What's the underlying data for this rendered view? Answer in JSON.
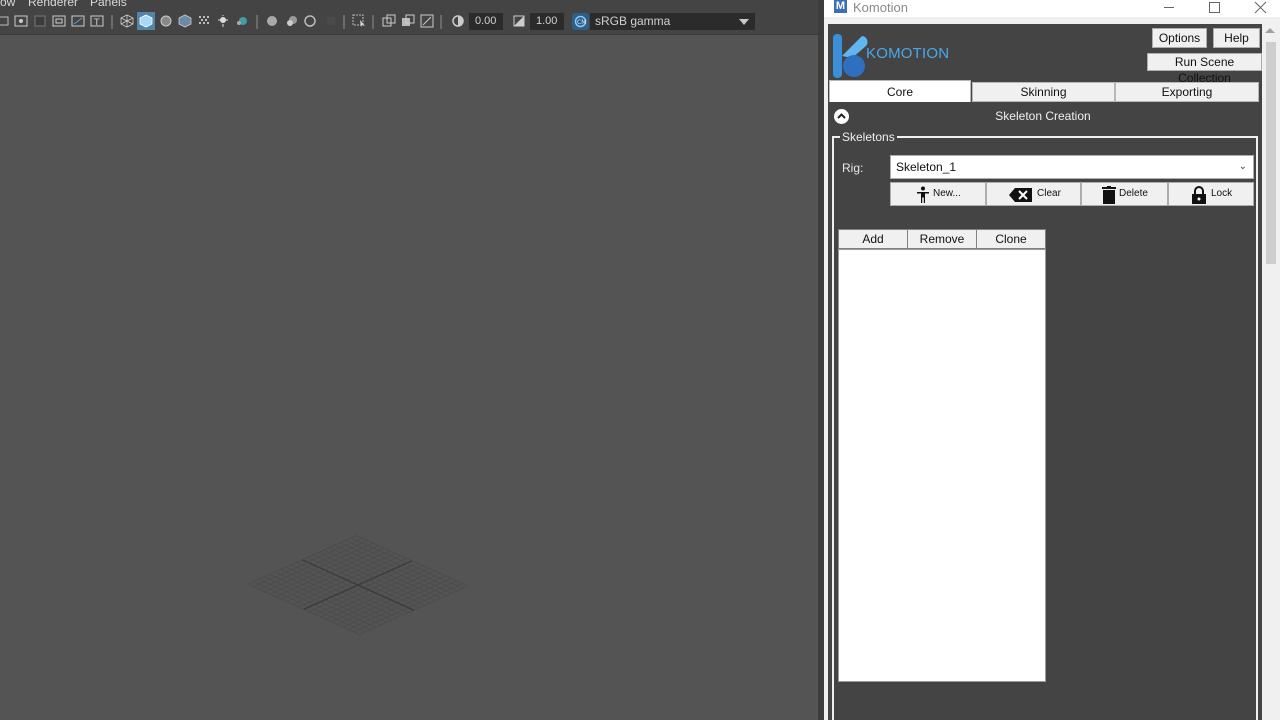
{
  "maya": {
    "menu": [
      "ow",
      "Renderer",
      "Panels"
    ],
    "toolbar": {
      "exposure_value": "0.00",
      "gamma_value": "1.00",
      "color_space": "sRGB gamma"
    }
  },
  "komotion": {
    "window_title": "Komotion",
    "app_icon_letter": "M",
    "brand_name": "KOMOTION",
    "buttons": {
      "options": "Options",
      "help": "Help",
      "run_scene_collection": "Run Scene Collection"
    },
    "tabs": [
      {
        "label": "Core",
        "active": true
      },
      {
        "label": "Skinning",
        "active": false
      },
      {
        "label": "Exporting",
        "active": false
      }
    ],
    "section_title": "Skeleton Creation",
    "group_title": "Skeletons",
    "rig": {
      "label": "Rig:",
      "selected": "Skeleton_1"
    },
    "actions": {
      "new": "New...",
      "clear": "Clear",
      "delete": "Delete",
      "lock": "Lock"
    },
    "list_buttons": {
      "add": "Add",
      "remove": "Remove",
      "clone": "Clone"
    },
    "skeleton_list": []
  },
  "colors": {
    "viewport_bg": "#545454",
    "panel_bg": "#444444",
    "brand_blue": "#4aa8e8",
    "toolbar_active": "#5aa0d8"
  }
}
